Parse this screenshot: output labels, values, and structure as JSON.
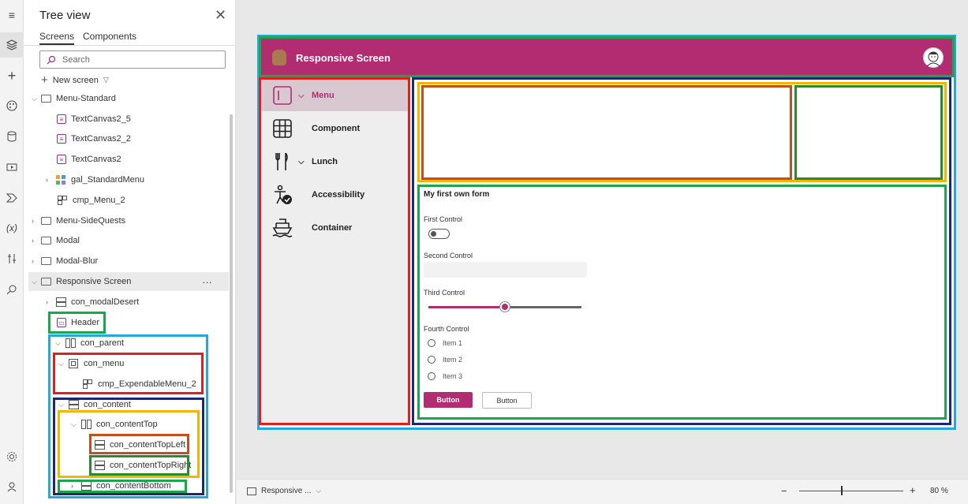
{
  "tree_panel": {
    "title": "Tree view",
    "tabs": [
      "Screens",
      "Components"
    ],
    "search_placeholder": "Search",
    "new_screen": "New screen",
    "nodes": [
      {
        "label": "Menu-Standard"
      },
      {
        "label": "TextCanvas2_5"
      },
      {
        "label": "TextCanvas2_2"
      },
      {
        "label": "TextCanvas2"
      },
      {
        "label": "gal_StandardMenu"
      },
      {
        "label": "cmp_Menu_2"
      },
      {
        "label": "Menu-SideQuests"
      },
      {
        "label": "Modal"
      },
      {
        "label": "Modal-Blur"
      },
      {
        "label": "Responsive Screen"
      },
      {
        "label": "con_modalDesert"
      },
      {
        "label": "Header"
      },
      {
        "label": "con_parent"
      },
      {
        "label": "con_menu"
      },
      {
        "label": "cmp_ExpendableMenu_2"
      },
      {
        "label": "con_content"
      },
      {
        "label": "con_contentTop"
      },
      {
        "label": "con_contentTopLeft"
      },
      {
        "label": "con_contentTopRight"
      },
      {
        "label": "con_contentBottom"
      }
    ],
    "more_options": "···"
  },
  "canvas": {
    "header_title": "Responsive Screen",
    "menu_items": [
      {
        "label": "Menu",
        "icon": "menu-box-icon"
      },
      {
        "label": "Component",
        "icon": "grid-icon"
      },
      {
        "label": "Lunch",
        "icon": "cutlery-icon"
      },
      {
        "label": "Accessibility",
        "icon": "accessibility-icon"
      },
      {
        "label": "Container",
        "icon": "ship-icon"
      }
    ],
    "form": {
      "title": "My first own form",
      "first_control": "First Control",
      "second_control": "Second Control",
      "third_control": "Third Control",
      "fourth_control": "Fourth Control",
      "slider_value": 0.5,
      "radio_items": [
        "Item 1",
        "Item 2",
        "Item 3"
      ],
      "button_primary": "Button",
      "button_secondary": "Button"
    }
  },
  "status_bar": {
    "screen_selector": "Responsive ...",
    "zoom_value": "80",
    "zoom_unit": "%"
  },
  "colors": {
    "accent": "#b22c72",
    "highlight_blue": "#27a7e0",
    "highlight_green": "#1aa64b",
    "highlight_red": "#e02020",
    "highlight_navy": "#1b2a6b",
    "highlight_yellow": "#f5b400",
    "highlight_orange": "#c0501d",
    "highlight_darkgreen": "#2b8a2b"
  }
}
